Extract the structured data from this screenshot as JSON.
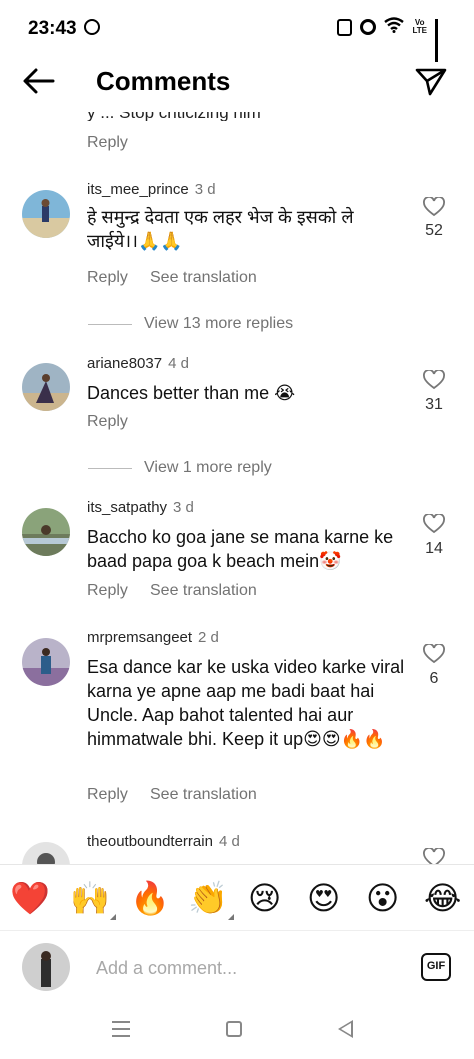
{
  "status_bar": {
    "time": "23:43",
    "icons": [
      "whatsapp-icon",
      "nfc-icon",
      "alarm-icon",
      "wifi-icon",
      "volte-icon",
      "signal-icon"
    ],
    "volte_top": "Vo",
    "volte_bottom": "LTE"
  },
  "header": {
    "title": "Comments",
    "back_icon": "arrow-left-icon",
    "share_icon": "paper-plane-icon"
  },
  "partial_comment": {
    "text_fragment": "y ... Stop criticizing him",
    "reply_label": "Reply"
  },
  "comments": [
    {
      "username": "its_mee_prince",
      "age": "3 d",
      "text": "हे समुन्द्र देवता एक लहर भेज के इसको ले जाईये।।🙏🙏",
      "likes": "52",
      "reply_label": "Reply",
      "see_translation": "See translation",
      "view_replies": "View 13 more replies"
    },
    {
      "username": "ariane8037",
      "age": "4 d",
      "text": "Dances better than me 😭",
      "likes": "31",
      "reply_label": "Reply",
      "view_replies": "View 1 more reply"
    },
    {
      "username": "its_satpathy",
      "age": "3 d",
      "text": "Baccho ko goa jane se mana karne ke baad papa goa k beach mein🤡",
      "likes": "14",
      "reply_label": "Reply",
      "see_translation": "See translation"
    },
    {
      "username": "mrpremsangeet",
      "age": "2 d",
      "text": "Esa dance kar ke uska video karke viral karna ye apne aap me badi baat hai Uncle. Aap bahot talented hai aur himmatwale bhi. Keep it up😍😍🔥🔥",
      "likes": "6",
      "reply_label": "Reply",
      "see_translation": "See translation"
    },
    {
      "username": "theoutboundterrain",
      "age": "4 d"
    }
  ],
  "emoji_bar": [
    "❤️",
    "🙌",
    "🔥",
    "👏",
    "😢",
    "😍",
    "😮",
    "😂"
  ],
  "composer": {
    "placeholder": "Add a comment...",
    "gif_label": "GIF"
  },
  "colors": {
    "secondary_text": "#737373",
    "primary_text": "#111111",
    "background": "#ffffff"
  }
}
